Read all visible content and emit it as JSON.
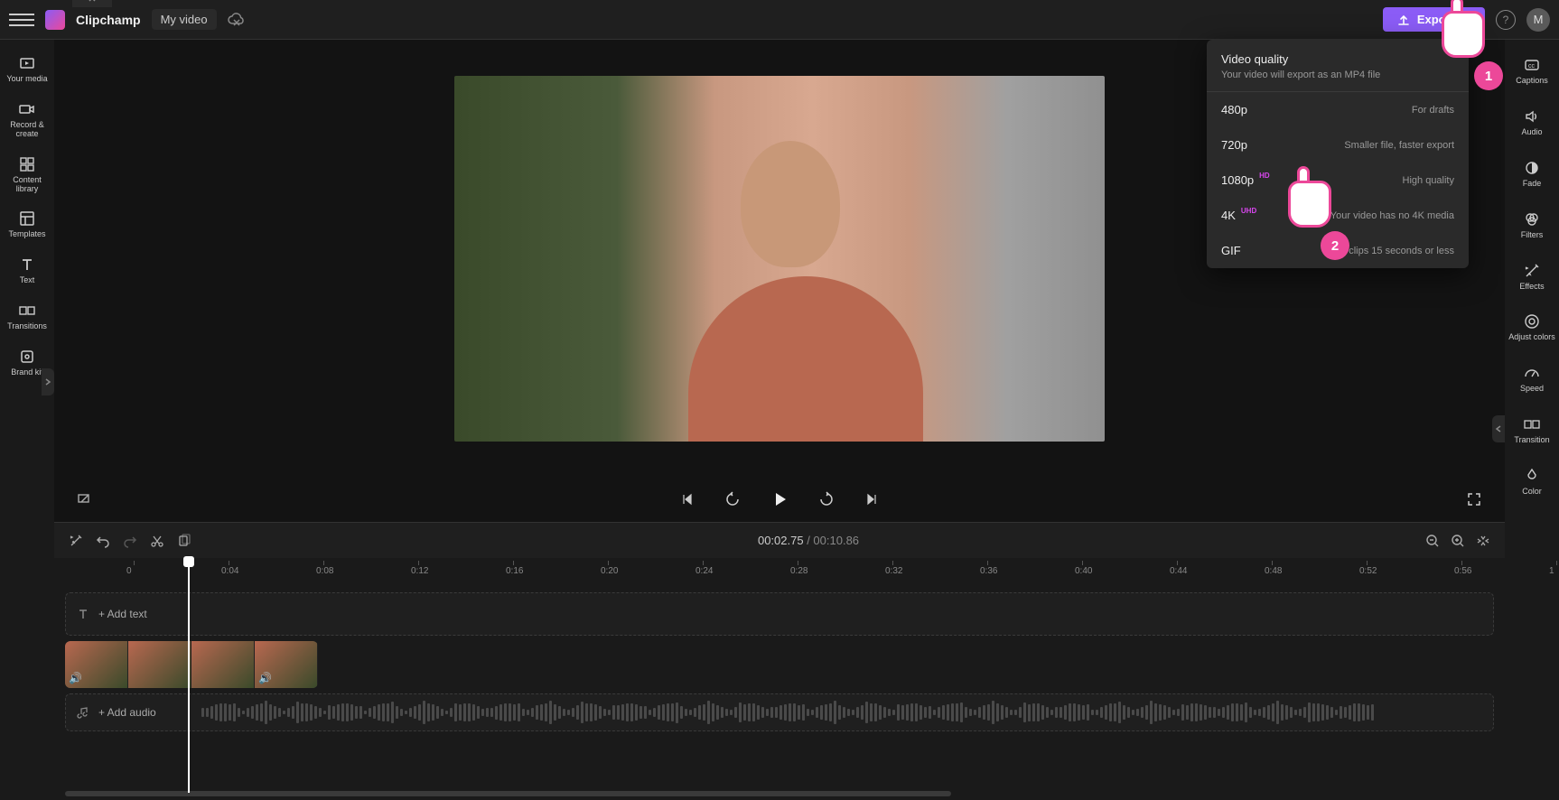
{
  "topbar": {
    "app_name": "Clipchamp",
    "video_name": "My video",
    "export_label": "Export",
    "help_char": "?",
    "avatar_initial": "M"
  },
  "left_rail": {
    "items": [
      {
        "label": "Your media"
      },
      {
        "label": "Record & create"
      },
      {
        "label": "Content library"
      },
      {
        "label": "Templates"
      },
      {
        "label": "Text"
      },
      {
        "label": "Transitions"
      },
      {
        "label": "Brand kit"
      }
    ]
  },
  "right_rail": {
    "items": [
      {
        "label": "Captions"
      },
      {
        "label": "Audio"
      },
      {
        "label": "Fade"
      },
      {
        "label": "Filters"
      },
      {
        "label": "Effects"
      },
      {
        "label": "Adjust colors"
      },
      {
        "label": "Speed"
      },
      {
        "label": "Transition"
      },
      {
        "label": "Color"
      }
    ]
  },
  "export_popup": {
    "title": "Video quality",
    "subtitle": "Your video will export as an MP4 file",
    "options": [
      {
        "label": "480p",
        "badge": "",
        "desc": "For drafts"
      },
      {
        "label": "720p",
        "badge": "",
        "desc": "Smaller file, faster export"
      },
      {
        "label": "1080p",
        "badge": "HD",
        "desc": "High quality"
      },
      {
        "label": "4K",
        "badge": "UHD",
        "desc": "Your video has no 4K media"
      },
      {
        "label": "GIF",
        "badge": "",
        "desc": "For clips 15 seconds or less"
      }
    ]
  },
  "pointers": {
    "one": "1",
    "two": "2"
  },
  "player": {
    "current_time": "00:02.75",
    "separator": " / ",
    "total_time": "00:10.86"
  },
  "ruler": {
    "ticks": [
      "0",
      "0:04",
      "0:08",
      "0:12",
      "0:16",
      "0:20",
      "0:24",
      "0:28",
      "0:32",
      "0:36",
      "0:40",
      "0:44",
      "0:48",
      "0:52",
      "0:56",
      "1"
    ]
  },
  "tracks": {
    "add_text": "+ Add text",
    "add_audio": "+ Add audio"
  }
}
